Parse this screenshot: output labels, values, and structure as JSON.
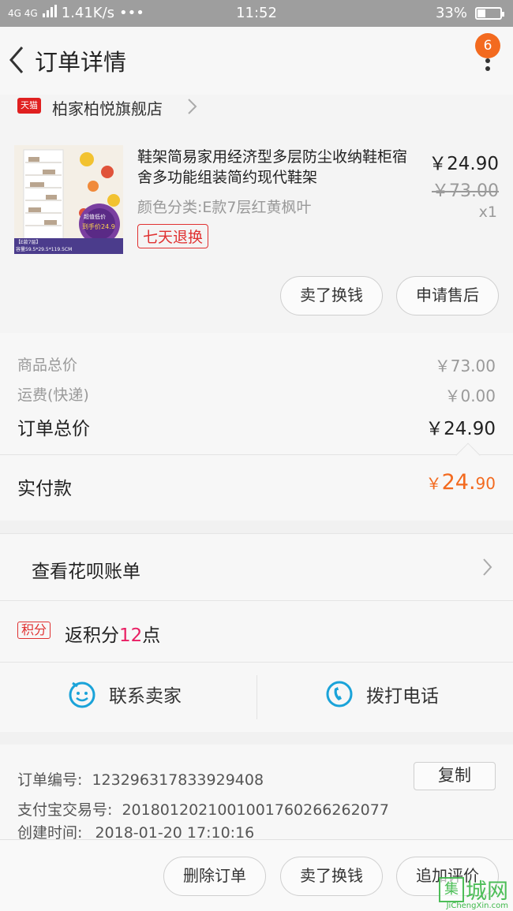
{
  "status": {
    "network": "4G 4G",
    "speed": "1.41K/s",
    "dots": "•••",
    "time": "11:52",
    "battery": "33%",
    "battery_level": 0.33
  },
  "nav": {
    "title": "订单详情",
    "badge": "6"
  },
  "shop": {
    "tag": "天猫",
    "name": "柏家柏悦旗舰店"
  },
  "product": {
    "title": "鞋架简易家用经济型多层防尘收纳鞋柜宿舍多功能组装简约现代鞋架",
    "sku": "颜色分类:E款7层红黄枫叶",
    "tag": "七天退换",
    "price": "￥24.90",
    "original_price": "￥73.00",
    "qty": "x1",
    "thumb_promo_top": "超值低价",
    "thumb_promo_price": "到手价24.9",
    "thumb_caption_top": "【E款7层】",
    "thumb_caption": "容量59.5*29.5*119.5CM",
    "actions": [
      "卖了换钱",
      "申请售后"
    ]
  },
  "summary": {
    "rows": [
      {
        "label": "商品总价",
        "value": "￥73.00"
      },
      {
        "label": "运费(快递)",
        "value": "￥0.00"
      },
      {
        "label": "订单总价",
        "value": "￥24.90"
      }
    ],
    "paid_label": "实付款",
    "paid_currency": "￥",
    "paid_int": "24.",
    "paid_dec": "90"
  },
  "huabei": {
    "label": "查看花呗账单"
  },
  "points": {
    "tag": "积分",
    "prefix": "返积分",
    "num": "12",
    "suffix": "点"
  },
  "contact": {
    "seller": "联系卖家",
    "phone": "拨打电话"
  },
  "info": {
    "order_no_label": "订单编号:",
    "order_no": "123296317833929408",
    "copy": "复制",
    "alipay_label": "支付宝交易号:",
    "alipay_no": "2018012021001001760266262077",
    "created_label": "创建时间:",
    "created": "2018-01-20 17:10:16"
  },
  "bottom": {
    "actions": [
      "删除订单",
      "卖了换钱",
      "追加评价"
    ]
  },
  "watermark": {
    "box": "集",
    "text": "城网",
    "url": "JiChengXin.com"
  },
  "colors": {
    "accent": "#f36a1f",
    "tmall": "#e02020",
    "tag_red": "#e03131",
    "points_num": "#e91e63",
    "contact_blue": "#1aa3d9"
  }
}
